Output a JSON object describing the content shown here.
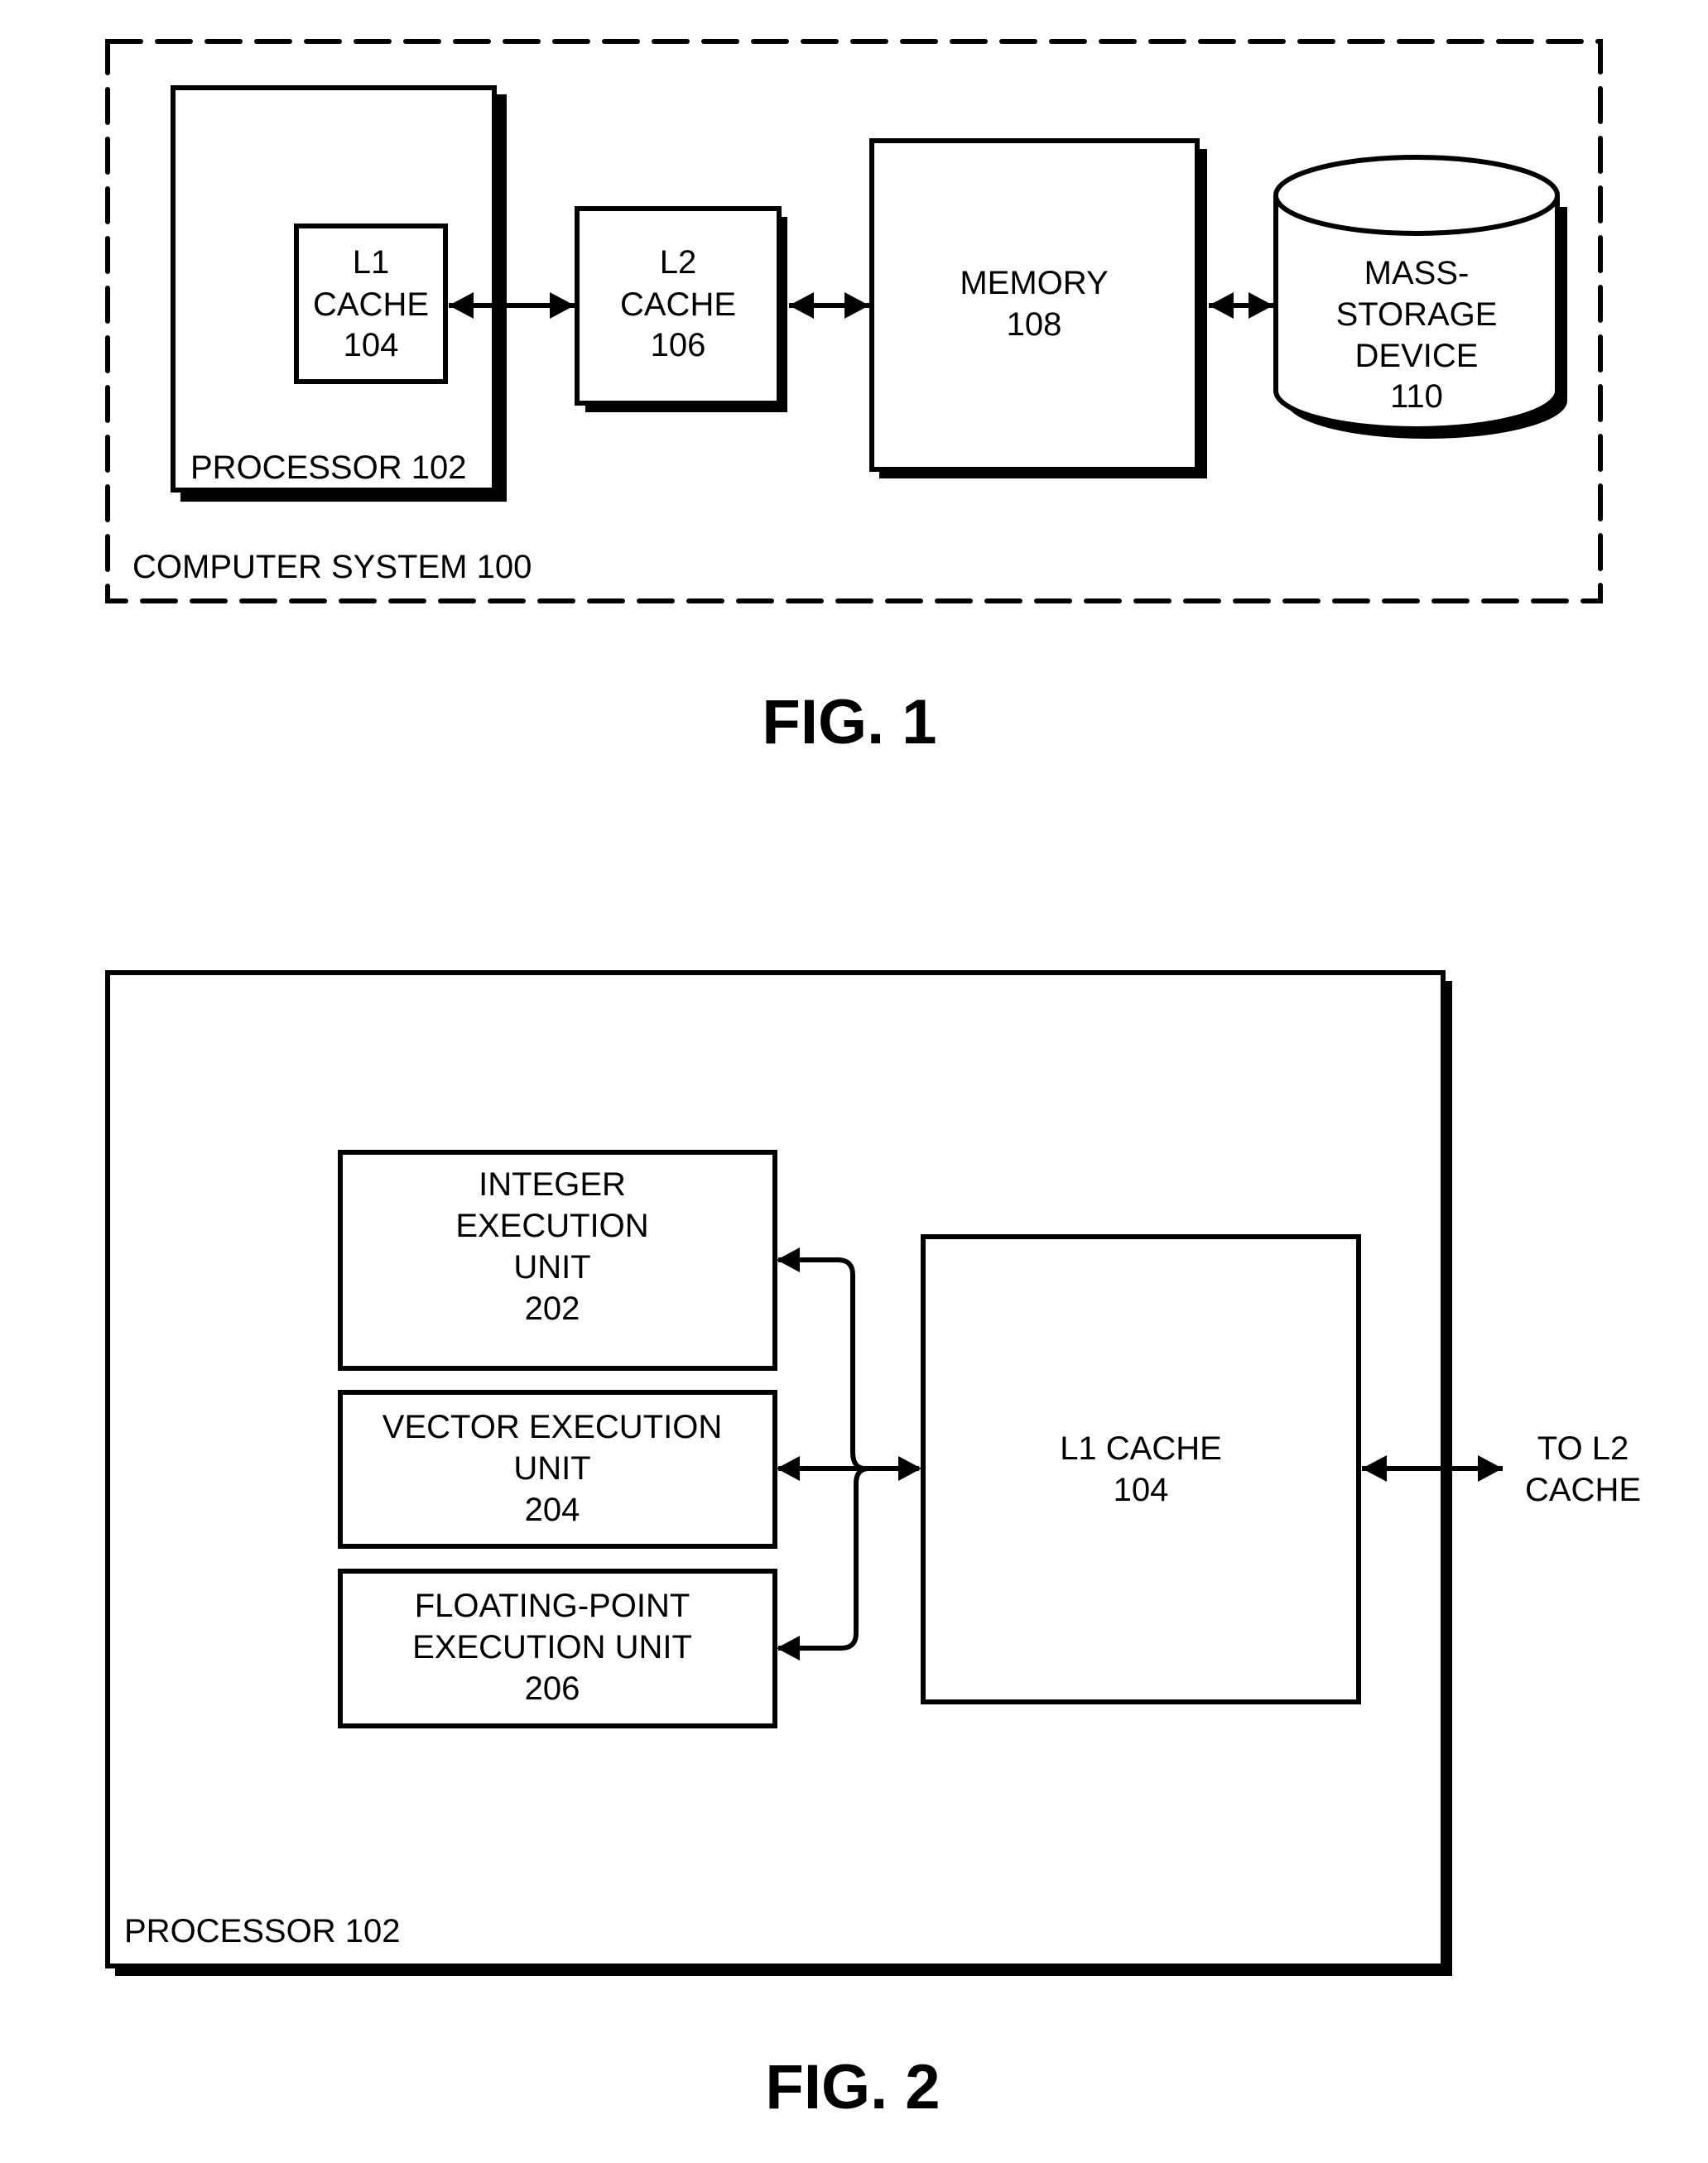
{
  "figure1": {
    "caption": "FIG. 1",
    "system_label": "COMPUTER SYSTEM 100",
    "processor_label": "PROCESSOR 102",
    "l1_cache": [
      "L1",
      "CACHE",
      "104"
    ],
    "l2_cache": [
      "L2",
      "CACHE",
      "106"
    ],
    "memory": [
      "MEMORY",
      "108"
    ],
    "mass_storage": [
      "MASS-",
      "STORAGE",
      "DEVICE",
      "110"
    ],
    "connections": [
      {
        "from": "L1 CACHE 104",
        "to": "L2 CACHE 106",
        "type": "bidirectional"
      },
      {
        "from": "L2 CACHE 106",
        "to": "MEMORY 108",
        "type": "bidirectional"
      },
      {
        "from": "MEMORY 108",
        "to": "MASS-STORAGE DEVICE 110",
        "type": "bidirectional"
      }
    ]
  },
  "figure2": {
    "caption": "FIG. 2",
    "processor_label": "PROCESSOR 102",
    "integer_unit": [
      "INTEGER",
      "EXECUTION",
      "UNIT",
      "202"
    ],
    "vector_unit": [
      "VECTOR EXECUTION",
      "UNIT",
      "204"
    ],
    "fp_unit": [
      "FLOATING-POINT",
      "EXECUTION UNIT",
      "206"
    ],
    "l1_cache": [
      "L1 CACHE",
      "104"
    ],
    "to_l2": [
      "TO L2",
      "CACHE"
    ],
    "connections": [
      {
        "from": "INTEGER EXECUTION UNIT 202",
        "to": "L1 CACHE 104",
        "type": "bidirectional"
      },
      {
        "from": "VECTOR EXECUTION UNIT 204",
        "to": "L1 CACHE 104",
        "type": "bidirectional"
      },
      {
        "from": "FLOATING-POINT EXECUTION UNIT 206",
        "to": "L1 CACHE 104",
        "type": "bidirectional"
      },
      {
        "from": "L1 CACHE 104",
        "to": "L2 CACHE",
        "type": "bidirectional"
      }
    ]
  }
}
